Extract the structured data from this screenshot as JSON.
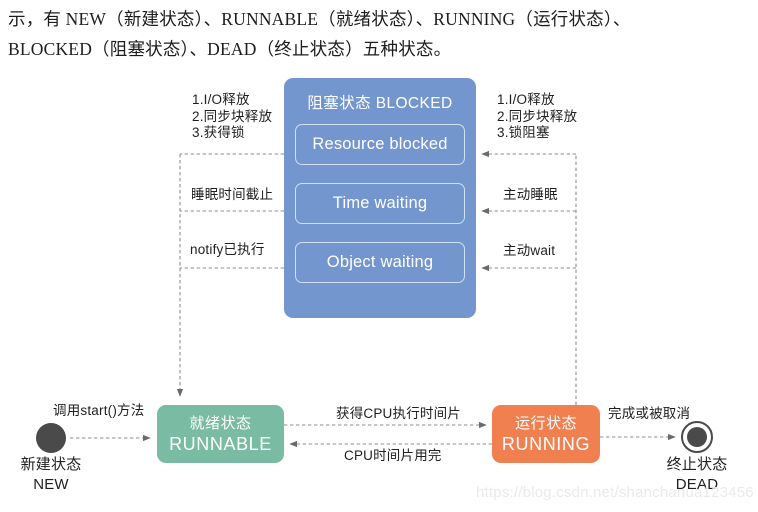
{
  "paragraph": {
    "line1": "示，有 NEW（新建状态）、RUNNABLE（就绪状态）、RUNNING（运行状态）、",
    "line2": "BLOCKED（阻塞状态）、DEAD（终止状态）五种状态。"
  },
  "diagram": {
    "blocked": {
      "title": "阻塞状态 BLOCKED",
      "color": "#7496cf",
      "substates": [
        {
          "label": "Resource blocked"
        },
        {
          "label": "Time waiting"
        },
        {
          "label": "Object waiting"
        }
      ]
    },
    "runnable": {
      "cn": "就绪状态",
      "en": "RUNNABLE",
      "color": "#79bba3"
    },
    "running": {
      "cn": "运行状态",
      "en": "RUNNING",
      "color": "#f08050"
    },
    "start_node": {
      "cn": "新建状态",
      "en": "NEW",
      "color": "#4a4a4a"
    },
    "end_node": {
      "cn": "终止状态",
      "en": "DEAD",
      "color": "#4a4a4a"
    },
    "left_transitions": [
      {
        "id": "resource-release",
        "lines": [
          "1.I/O释放",
          "2.同步块释放",
          "3.获得锁"
        ]
      },
      {
        "id": "sleep-timeout",
        "lines": [
          "睡眠时间截止"
        ]
      },
      {
        "id": "notify-executed",
        "lines": [
          "notify已执行"
        ]
      }
    ],
    "right_transitions": [
      {
        "id": "lock-blocked",
        "lines": [
          "1.I/O释放",
          "2.同步块释放",
          "3.锁阻塞"
        ]
      },
      {
        "id": "active-sleep",
        "lines": [
          "主动睡眠"
        ]
      },
      {
        "id": "active-wait",
        "lines": [
          "主动wait"
        ]
      }
    ],
    "bottom_transitions": {
      "start_call": "调用start()方法",
      "cpu_acquire": "获得CPU执行时间片",
      "cpu_exhausted": "CPU时间片用完",
      "finish_or_cancel": "完成或被取消"
    }
  },
  "watermark": "https://blog.csdn.net/shanchanua123456"
}
